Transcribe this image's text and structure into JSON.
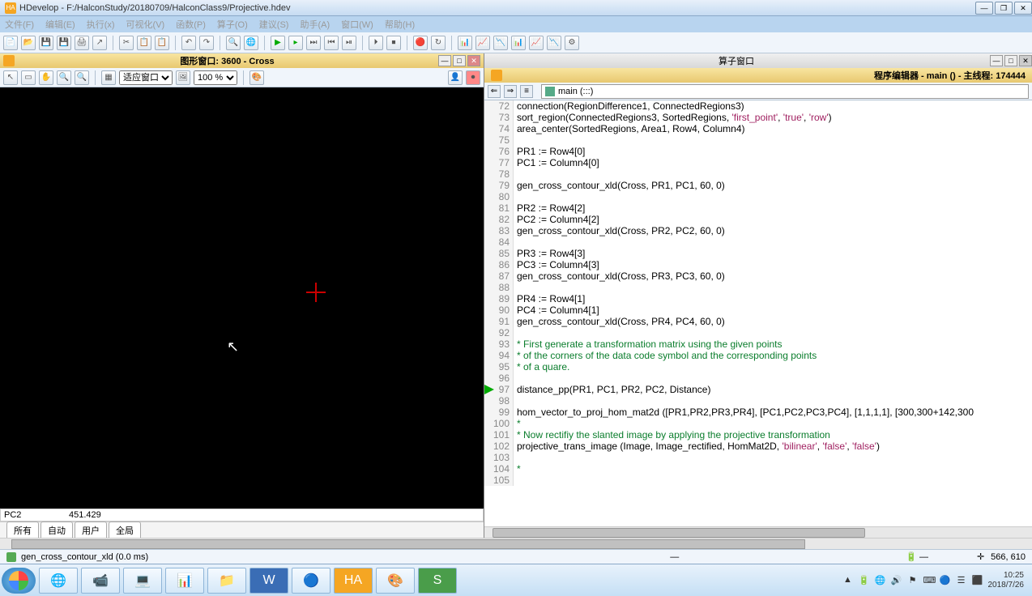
{
  "window": {
    "title": "HDevelop - F:/HalconStudy/20180709/HalconClass9/Projective.hdev",
    "icon_label": "HA"
  },
  "menu": {
    "items": [
      "文件(F)",
      "编辑(E)",
      "执行(x)",
      "可视化(V)",
      "函数(P)",
      "算子(O)",
      "建议(S)",
      "助手(A)",
      "窗口(W)",
      "帮助(H)"
    ]
  },
  "graphics_window": {
    "title": "图形窗口: 3600 - Cross",
    "fit_label": "适应窗口",
    "zoom_label": "100 %"
  },
  "var_panel": {
    "name": "PC2",
    "value": "451.429",
    "tabs": [
      "所有",
      "自动",
      "用户",
      "全局"
    ]
  },
  "operator_window": {
    "title": "算子窗口"
  },
  "program_editor": {
    "title": "程序编辑器 - main () - 主线程: 174444",
    "procedure": "main (:::)"
  },
  "code": {
    "lines": [
      {
        "n": 72,
        "t": "connection(RegionDifference1, ConnectedRegions3)",
        "c": "func"
      },
      {
        "n": 73,
        "t": "sort_region(ConnectedRegions3, SortedRegions, 'first_point', 'true', 'row')",
        "c": "func"
      },
      {
        "n": 74,
        "t": "area_center(SortedRegions, Area1, Row4, Column4)",
        "c": "func"
      },
      {
        "n": 75,
        "t": "",
        "c": "func"
      },
      {
        "n": 76,
        "t": "PR1 := Row4[0]",
        "c": "func"
      },
      {
        "n": 77,
        "t": "PC1 := Column4[0]",
        "c": "func"
      },
      {
        "n": 78,
        "t": "",
        "c": "func"
      },
      {
        "n": 79,
        "t": "gen_cross_contour_xld(Cross, PR1, PC1, 60, 0)",
        "c": "func"
      },
      {
        "n": 80,
        "t": "",
        "c": "func"
      },
      {
        "n": 81,
        "t": "PR2 := Row4[2]",
        "c": "func"
      },
      {
        "n": 82,
        "t": "PC2 := Column4[2]",
        "c": "func"
      },
      {
        "n": 83,
        "t": "gen_cross_contour_xld(Cross, PR2, PC2, 60, 0)",
        "c": "func"
      },
      {
        "n": 84,
        "t": "",
        "c": "func"
      },
      {
        "n": 85,
        "t": "PR3 := Row4[3]",
        "c": "func"
      },
      {
        "n": 86,
        "t": "PC3 := Column4[3]",
        "c": "func"
      },
      {
        "n": 87,
        "t": "gen_cross_contour_xld(Cross, PR3, PC3, 60, 0)",
        "c": "func"
      },
      {
        "n": 88,
        "t": "",
        "c": "func"
      },
      {
        "n": 89,
        "t": "PR4 := Row4[1]",
        "c": "func"
      },
      {
        "n": 90,
        "t": "PC4 := Column4[1]",
        "c": "func"
      },
      {
        "n": 91,
        "t": "gen_cross_contour_xld(Cross, PR4, PC4, 60, 0)",
        "c": "func"
      },
      {
        "n": 92,
        "t": "",
        "c": "func"
      },
      {
        "n": 93,
        "t": "* First generate a transformation matrix using the given points",
        "c": "comment"
      },
      {
        "n": 94,
        "t": "* of the corners of the data code symbol and the corresponding points",
        "c": "comment"
      },
      {
        "n": 95,
        "t": "* of a quare.",
        "c": "comment"
      },
      {
        "n": 96,
        "t": "",
        "c": "func"
      },
      {
        "n": 97,
        "t": "distance_pp(PR1, PC1, PR2, PC2, Distance)",
        "c": "func",
        "ip": true
      },
      {
        "n": 98,
        "t": "",
        "c": "func"
      },
      {
        "n": 99,
        "t": "hom_vector_to_proj_hom_mat2d ([PR1,PR2,PR3,PR4], [PC1,PC2,PC3,PC4], [1,1,1,1], [300,300+142,300",
        "c": "func"
      },
      {
        "n": 100,
        "t": "*",
        "c": "comment"
      },
      {
        "n": 101,
        "t": "* Now rectifiy the slanted image by applying the projective transformation",
        "c": "comment"
      },
      {
        "n": 102,
        "t": "projective_trans_image (Image, Image_rectified, HomMat2D, 'bilinear', 'false', 'false')",
        "c": "func"
      },
      {
        "n": 103,
        "t": "",
        "c": "func"
      },
      {
        "n": 104,
        "t": "*",
        "c": "comment"
      },
      {
        "n": 105,
        "t": "",
        "c": "func"
      }
    ]
  },
  "status": {
    "text": "gen_cross_contour_xld (0.0 ms)",
    "coords": "566, 610"
  },
  "taskbar": {
    "apps": [
      "🌐",
      "📹",
      "💻",
      "📊",
      "📁",
      "W",
      "🔵",
      "HA",
      "🎨",
      "S"
    ],
    "time": "10:25",
    "date": "2018/7/26"
  }
}
